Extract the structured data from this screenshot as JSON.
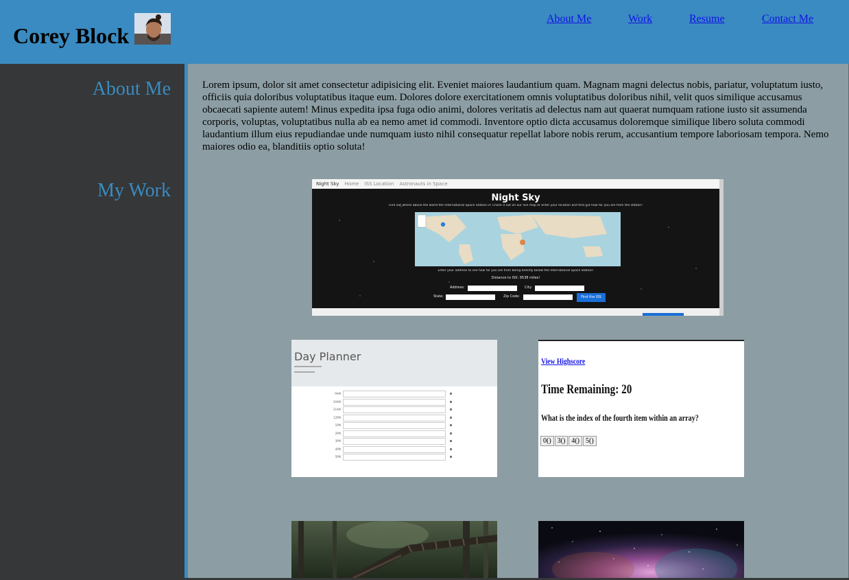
{
  "header": {
    "title": "Corey Block",
    "nav": [
      "About Me",
      "Work",
      "Resume",
      "Contact Me"
    ]
  },
  "sidebar": {
    "headings": [
      "About Me",
      "My Work"
    ]
  },
  "main": {
    "about_text": "Lorem ipsum, dolor sit amet consectetur adipisicing elit. Eveniet maiores laudantium quam. Magnam magni delectus nobis, pariatur, voluptatum iusto, officiis quia doloribus voluptatibus itaque eum. Dolores dolore exercitationem omnis voluptatibus doloribus nihil, velit quos similique accusamus obcaecati sapiente autem! Minus expedita ipsa fuga odio animi, dolores veritatis ad delectus nam aut quaerat numquam ratione iusto sit assumenda corporis, voluptas, voluptatibus nulla ab ea nemo amet id commodi. Inventore optio dicta accusamus doloremque similique libero soluta commodi laudantium illum eius repudiandae unde numquam iusto nihil consequatur repellat labore nobis rerum, accusantium tempore laboriosam tempora. Nemo maiores odio ea, blanditiis optio soluta!"
  },
  "work": {
    "night_sky": {
      "nav_brand": "Night Sky",
      "nav_links": [
        "Home",
        "ISS Location",
        "Astronauts in Space"
      ],
      "title": "Night Sky",
      "subtitle": "Find out where above the world the International Space Station is! Check it out on our live map or enter your location and find out how far you are from the station!",
      "prompt": "Enter your address to see how far you are from being directly below the International Space Station!",
      "distance": "Distance to ISS: 9538 miles!",
      "address_label": "Address:",
      "city_label": "City:",
      "state_label": "State:",
      "zip_label": "Zip Code:",
      "button": "Find the ISS"
    },
    "day_planner": {
      "title": "Day Planner",
      "hours": [
        "9AM",
        "10AM",
        "11AM",
        "12PM",
        "1PM",
        "2PM",
        "3PM",
        "4PM",
        "5PM"
      ]
    },
    "quiz": {
      "highscore_link": "View Highscore",
      "timer": "Time Remaining: 20",
      "question": "What is the index of the fourth item within an array?",
      "answers": [
        "0()",
        "3()",
        "4()",
        "5()"
      ]
    }
  },
  "colors": {
    "header_blue": "#3a8bc1",
    "sidebar_dark": "#353738",
    "main_gray": "#8c9ea4",
    "link_blue": "#1010e6"
  }
}
